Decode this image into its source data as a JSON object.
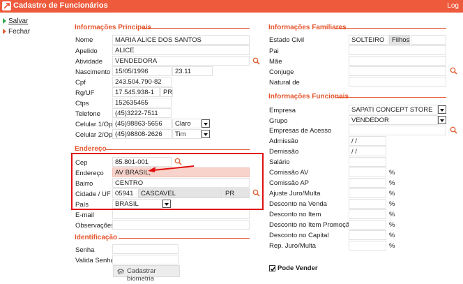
{
  "window": {
    "title": "Cadastro de Funcionários",
    "log": "Log"
  },
  "side": {
    "save": "Salvar",
    "close": "Fechar"
  },
  "sections": {
    "principais": "Informações Principais",
    "endereco": "Endereço",
    "identificacao": "Identificação",
    "familiares": "Informações Familiares",
    "funcionais": "Informações Funcionais"
  },
  "principais": {
    "nome_label": "Nome",
    "nome": "MARIA ALICE DOS SANTOS",
    "apelido_label": "Apelido",
    "apelido": "ALICE",
    "atividade_label": "Atividade",
    "atividade": "VENDEDORA",
    "nascimento_label": "Nascimento",
    "nascimento": "15/05/1996",
    "idade": "23.11",
    "cpf_label": "Cpf",
    "cpf": "243.504.790-82",
    "rg_label": "Rg/UF",
    "rg": "17.545.938-1",
    "rg_uf": "PR",
    "ctps_label": "Ctps",
    "ctps": "152635465",
    "telefone_label": "Telefone",
    "telefone": "(45)3222-7511",
    "cel1_label": "Celular 1/Op",
    "cel1": "(45)98863-5656",
    "cel1_op": "Claro",
    "cel2_label": "Celular 2/Op",
    "cel2": "(45)98808-2626",
    "cel2_op": "Tim"
  },
  "endereco": {
    "cep_label": "Cep",
    "cep": "85.801-001",
    "endereco_label": "Endereço",
    "endereco": "AV BRASIL,",
    "bairro_label": "Bairro",
    "bairro": "CENTRO",
    "cidade_label": "Cidade / UF",
    "cidade_cod": "05941",
    "cidade": "CASCAVEL",
    "uf": "PR",
    "pais_label": "País",
    "pais": "BRASIL",
    "email_label": "E-mail",
    "email": "",
    "obs_label": "Observações",
    "obs": ""
  },
  "identificacao": {
    "senha_label": "Senha",
    "valida_label": "Valida Senha",
    "biometria_button": "Cadastrar biometria"
  },
  "familiares": {
    "estado_civil_label": "Estado Civil",
    "estado_civil": "SOLTEIRO",
    "filhos_label": "Filhos",
    "pai_label": "Pai",
    "mae_label": "Mãe",
    "conjuge_label": "Conjuge",
    "natural_label": "Natural de"
  },
  "funcionais": {
    "empresa_label": "Empresa",
    "empresa": "SAPATI CONCEPT STORE",
    "grupo_label": "Grupo",
    "grupo": "VENDEDOR",
    "empresas_acesso_label": "Empresas de Acesso",
    "admissao_label": "Admissão",
    "admissao": " / /",
    "demissao_label": "Demissão",
    "demissao": " / /",
    "salario_label": "Salário",
    "comissao_av_label": "Comissão AV",
    "comissao_ap_label": "Comissão AP",
    "ajuste_juro_label": "Ajuste Juro/Multa",
    "desc_venda_label": "Desconto na Venda",
    "desc_item_label": "Desconto no Item",
    "desc_item_promo_label": "Desconto no Item Promoção",
    "desc_capital_label": "Desconto no Capital",
    "rep_juro_label": "Rep. Juro/Multa",
    "pct": "%",
    "pode_vender_label": "Pode Vender",
    "pode_vender": true
  },
  "colors": {
    "accent": "#ee5a3c",
    "highlight": "#e01010"
  },
  "icons": [
    "app-icon",
    "search-icon",
    "fingerprint-icon",
    "checkmark-icon",
    "dropdown-arrow-icon"
  ]
}
